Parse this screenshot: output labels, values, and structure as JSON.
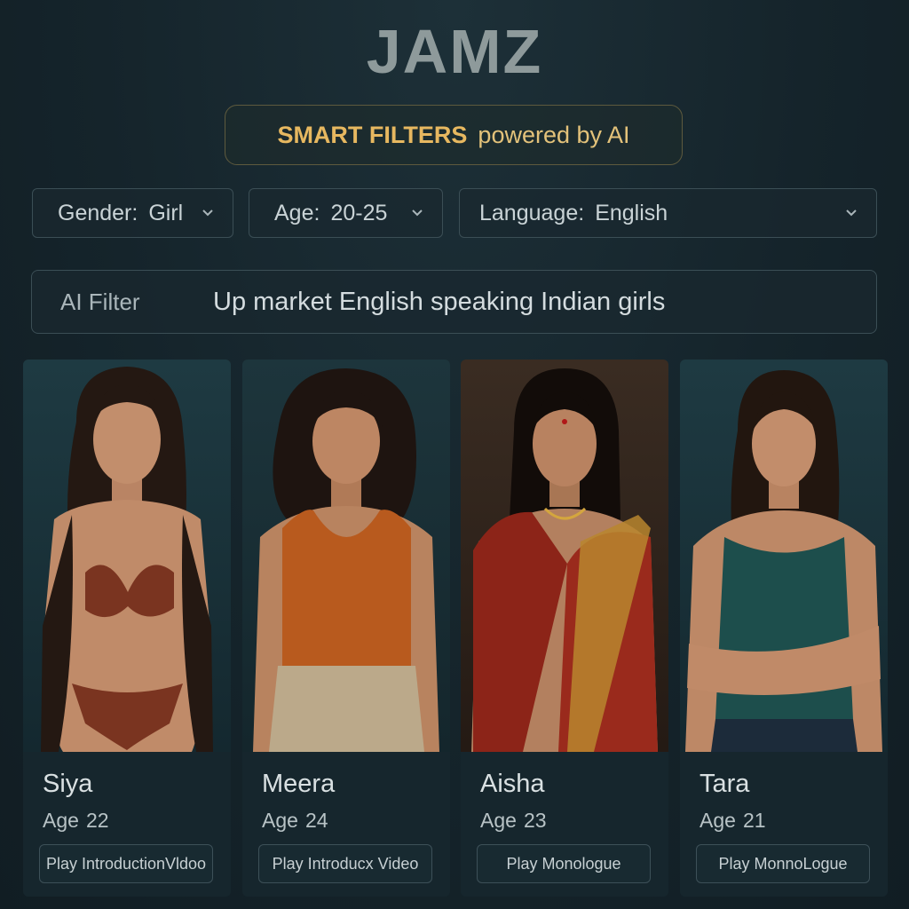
{
  "app": {
    "title": "JAMZ"
  },
  "badge": {
    "strong": "SMART FILTERS",
    "soft": "powered by AI"
  },
  "filters": [
    {
      "label": "Gender:",
      "value": "Girl"
    },
    {
      "label": "Age:",
      "value": "20-25"
    },
    {
      "label": "Language:",
      "value": "English"
    }
  ],
  "ai_filter": {
    "label": "AI Filter",
    "value": "Up market English speaking Indian girls"
  },
  "profiles": [
    {
      "name": "Siya",
      "age_label": "Age",
      "age": "22",
      "button": "Play IntroductionVldoo",
      "outfit": "bikini"
    },
    {
      "name": "Meera",
      "age_label": "Age",
      "age": "24",
      "button": "Play Introducx Video",
      "outfit": "tank-top"
    },
    {
      "name": "Aisha",
      "age_label": "Age",
      "age": "23",
      "button": "Play Monologue",
      "outfit": "saree"
    },
    {
      "name": "Tara",
      "age_label": "Age",
      "age": "21",
      "button": "Play MonnoLogue",
      "outfit": "tank-top"
    }
  ],
  "colors": {
    "background": "#15242b",
    "accent_gold": "#e7b860",
    "card": "#16262d",
    "border": "#3b4e55"
  }
}
